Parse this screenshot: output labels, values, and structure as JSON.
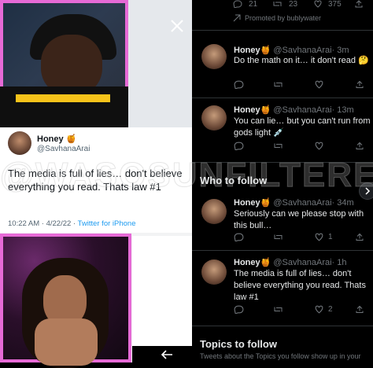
{
  "top_stats": {
    "replies": "21",
    "retweets": "23",
    "likes": "375"
  },
  "promoted": "Promoted by bublywater",
  "tweets": [
    {
      "name": "Honey",
      "emoji": "🍯",
      "handle": "@SavhanaArai",
      "time": "· 3m",
      "text": "Do the math on it… it don't read 🤔"
    },
    {
      "name": "Honey",
      "emoji": "🍯",
      "handle": "@SavhanaArai",
      "time": "· 13m",
      "text": "You can lie… but you can't run from gods light 💉"
    },
    {
      "name": "Honey",
      "emoji": "🍯",
      "handle": "@SavhanaArai",
      "time": "· 34m",
      "text": "Seriously can we please stop with this bull…",
      "replies": "",
      "retweets": "",
      "likes": "1"
    },
    {
      "name": "Honey",
      "emoji": "🍯",
      "handle": "@SavhanaArai",
      "time": "· 1h",
      "text": "The media is full of lies… don't believe everything you read. Thats law #1",
      "likes": "2"
    }
  ],
  "who_to_follow": "Who to follow",
  "topics_to_follow": "Topics to follow",
  "topics_subtitle": "Tweets about the Topics you follow show up in your",
  "card": {
    "name": "Honey",
    "emoji": "🍯",
    "handle": "@SavhanaArai",
    "text": "The media is full of lies… don't believe everything you read. Thats law #1",
    "time": "10:22 AM · 4/22/22 · ",
    "source": "Twitter for iPhone"
  },
  "watermark": "@WASOSUNFILTERE"
}
